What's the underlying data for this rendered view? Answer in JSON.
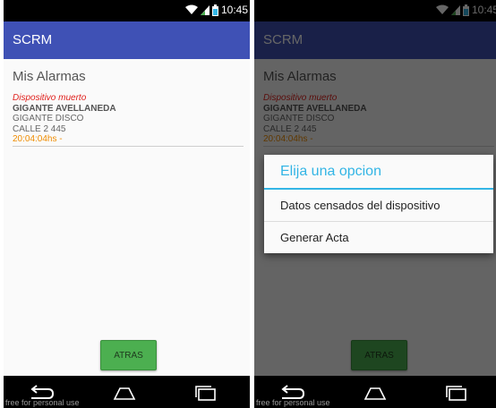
{
  "status_bar": {
    "time": "10:45"
  },
  "app_bar": {
    "title": "SCRM"
  },
  "section": {
    "title": "Mis Alarmas"
  },
  "alarm": {
    "status": "Dispositivo muerto",
    "name": "GIGANTE AVELLANEDA",
    "line1": "GIGANTE DISCO",
    "line2": "CALLE 2 445",
    "time": "20:04:04hs -"
  },
  "back_button": {
    "label": "ATRAS"
  },
  "dialog": {
    "title": "Elija una opcion",
    "options": [
      "Datos censados del dispositivo",
      "Generar Acta"
    ]
  },
  "watermark": "free for personal use",
  "icons": [
    "wifi-icon",
    "signal-icon",
    "battery-icon",
    "back-icon",
    "home-icon",
    "recent-apps-icon"
  ],
  "colors": {
    "app_bar": "#3f51b5",
    "button": "#4caf50",
    "dialog_accent": "#33b5e5",
    "alarm_status": "#e0201c",
    "alarm_time": "#f08c00"
  }
}
